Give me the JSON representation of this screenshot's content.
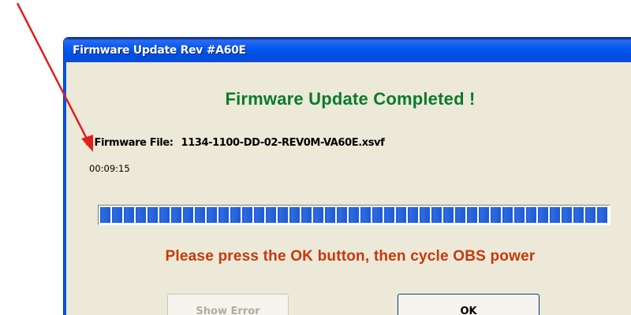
{
  "window": {
    "title": "Firmware Update  Rev #A60E"
  },
  "dialog": {
    "heading": "Firmware Update Completed !",
    "file_prefix": ">",
    "file_label": "Firmware File:",
    "file_name": "1134-1100-DD-02-REV0M-VA60E.xsvf",
    "elapsed_time": "00:09:15",
    "progress_percent": 100,
    "notice": "Please press the OK button, then cycle OBS power"
  },
  "buttons": {
    "show_error_label": "Show Error",
    "ok_label": "OK"
  },
  "colors": {
    "heading": "#0A7A2A",
    "notice": "#C8380A",
    "progress": "#1C5BD4",
    "arrow": "#E0201A"
  }
}
